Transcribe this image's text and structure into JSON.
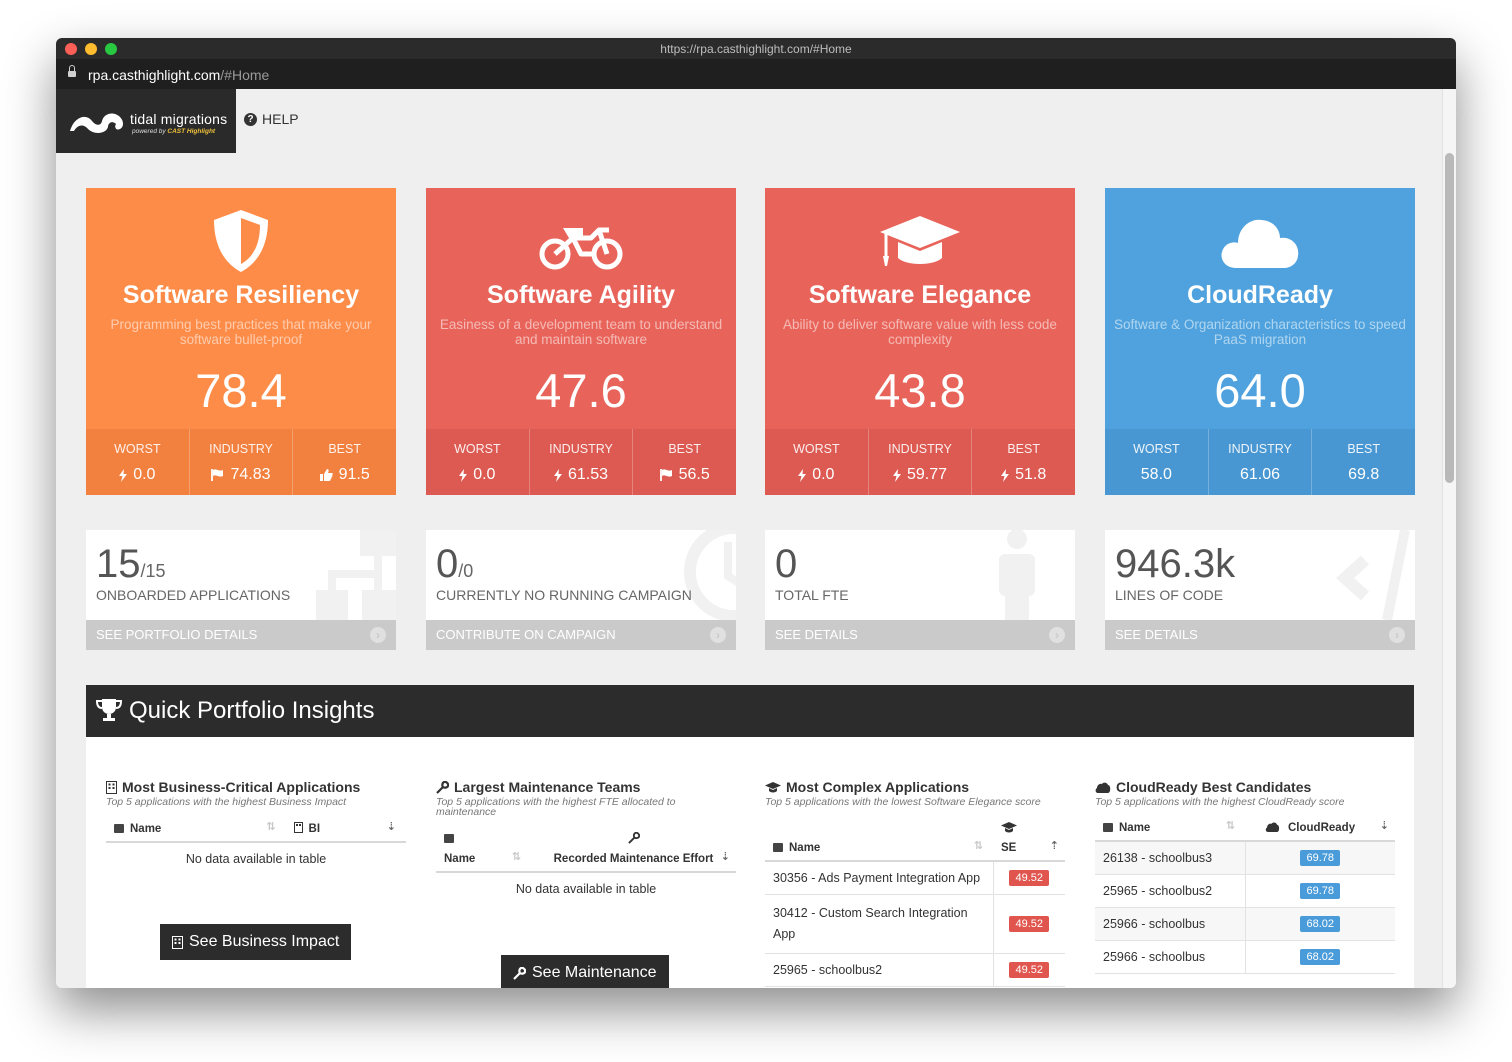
{
  "browser": {
    "title_url": "https://rpa.casthighlight.com/#Home",
    "address_host": "rpa.casthighlight.com",
    "address_path": "/#Home"
  },
  "header": {
    "logo_text": "tidal migrations",
    "logo_sub_prefix": "powered by",
    "logo_sub_brand": "CAST Highlight",
    "help_label": "HELP"
  },
  "metrics": [
    {
      "title": "Software Resiliency",
      "description": "Programming best practices that make your software bullet-proof",
      "score": "78.4",
      "color": "#fd8c49",
      "icon": "shield-icon",
      "worst_label": "WORST",
      "worst": "0.0",
      "industry_label": "INDUSTRY",
      "industry": "74.83",
      "best_label": "BEST",
      "best": "91.5"
    },
    {
      "title": "Software Agility",
      "description": "Easiness of a development team to understand and maintain software",
      "score": "47.6",
      "color": "#e8645a",
      "icon": "motorcycle-icon",
      "worst_label": "WORST",
      "worst": "0.0",
      "industry_label": "INDUSTRY",
      "industry": "61.53",
      "best_label": "BEST",
      "best": "56.5"
    },
    {
      "title": "Software Elegance",
      "description": "Ability to deliver software value with less code complexity",
      "score": "43.8",
      "color": "#e8645a",
      "icon": "graduation-cap-icon",
      "worst_label": "WORST",
      "worst": "0.0",
      "industry_label": "INDUSTRY",
      "industry": "59.77",
      "best_label": "BEST",
      "best": "51.8"
    },
    {
      "title": "CloudReady",
      "description": "Software & Organization characteristics to speed PaaS migration",
      "score": "64.0",
      "color": "#4fa2dd",
      "icon": "cloud-icon",
      "worst_label": "WORST",
      "worst": "58.0",
      "industry_label": "INDUSTRY",
      "industry": "61.06",
      "best_label": "BEST",
      "best": "69.8"
    }
  ],
  "kpis": [
    {
      "value": "15",
      "sub": "/15",
      "label": "ONBOARDED APPLICATIONS",
      "link": "SEE PORTFOLIO DETAILS",
      "icon": "sitemap-icon"
    },
    {
      "value": "0",
      "sub": "/0",
      "label": "CURRENTLY NO RUNNING CAMPAIGN",
      "link": "CONTRIBUTE ON CAMPAIGN",
      "icon": "clock-icon"
    },
    {
      "value": "0",
      "sub": "",
      "label": "TOTAL FTE",
      "link": "SEE DETAILS",
      "icon": "person-icon"
    },
    {
      "value": "946.3k",
      "sub": "",
      "label": "LINES OF CODE",
      "link": "SEE DETAILS",
      "icon": "code-icon"
    }
  ],
  "insights": {
    "title": "Quick Portfolio Insights",
    "business": {
      "title": "Most Business-Critical Applications",
      "description": "Top 5 applications with the highest Business Impact",
      "col_name": "Name",
      "col_value": "BI",
      "empty": "No data available in table",
      "button": "See Business Impact"
    },
    "maintenance": {
      "title": "Largest Maintenance Teams",
      "description": "Top 5 applications with the highest FTE allocated to maintenance",
      "col_name": "Name",
      "col_value": "Recorded Maintenance Effort",
      "empty": "No data available in table",
      "button": "See Maintenance"
    },
    "complex": {
      "title": "Most Complex Applications",
      "description": "Top 5 applications with the lowest Software Elegance score",
      "col_name": "Name",
      "col_value": "SE",
      "rows": [
        {
          "name": "30356 - Ads Payment Integration App",
          "score": "49.52"
        },
        {
          "name": "30412 - Custom Search Integration App",
          "score": "49.52"
        },
        {
          "name": "25965 - schoolbus2",
          "score": "49.52"
        }
      ]
    },
    "cloudready": {
      "title": "CloudReady Best Candidates",
      "description": "Top 5 applications with the highest CloudReady score",
      "col_name": "Name",
      "col_value": "CloudReady",
      "rows": [
        {
          "name": "26138 - schoolbus3",
          "score": "69.78"
        },
        {
          "name": "25965 - schoolbus2",
          "score": "69.78"
        },
        {
          "name": "25966 - schoolbus",
          "score": "68.02"
        },
        {
          "name": "25966 - schoolbus",
          "score": "68.02"
        }
      ]
    }
  }
}
